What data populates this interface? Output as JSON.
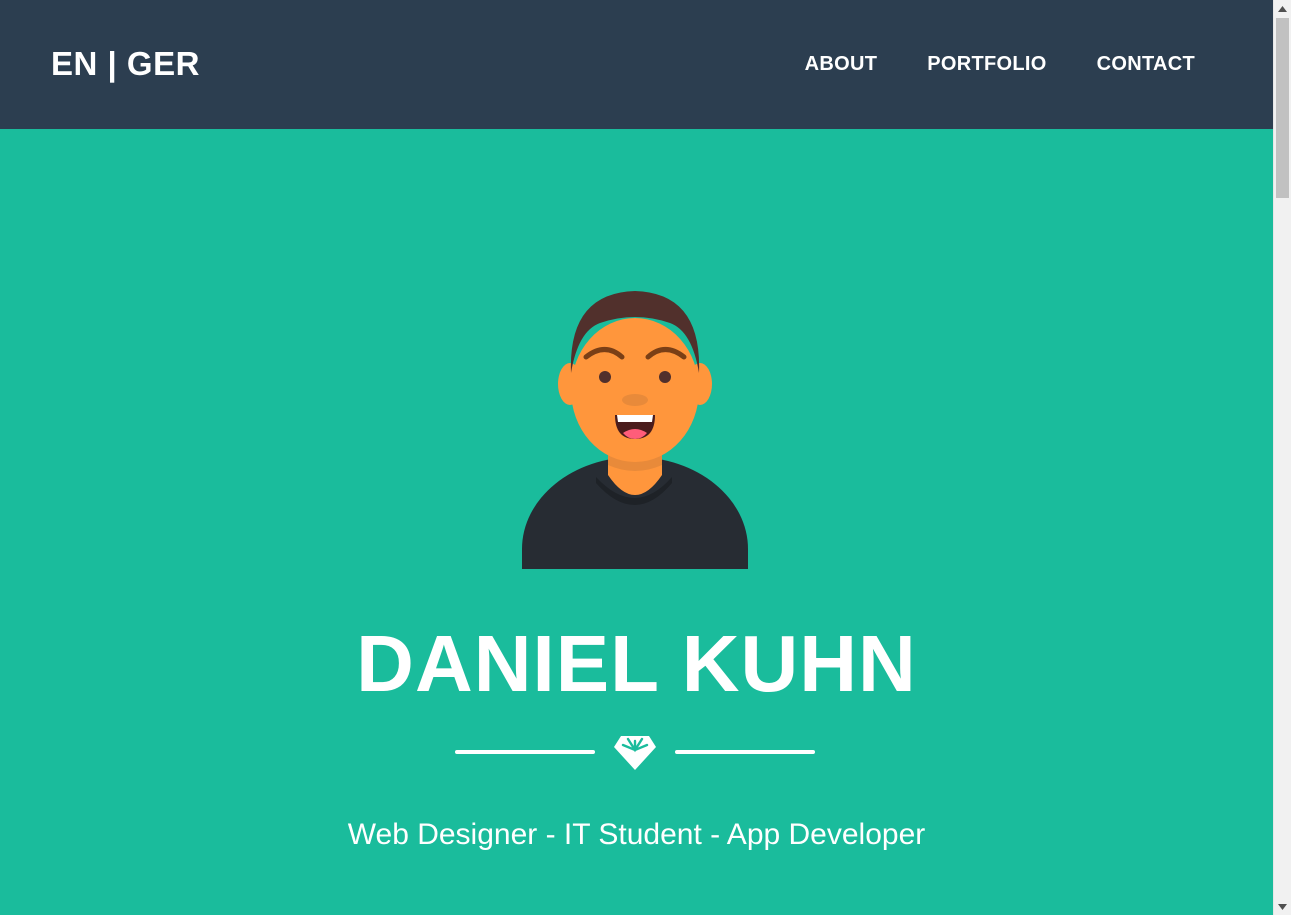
{
  "header": {
    "brand": "EN | GER",
    "nav": [
      {
        "label": "ABOUT"
      },
      {
        "label": "PORTFOLIO"
      },
      {
        "label": "CONTACT"
      }
    ]
  },
  "hero": {
    "name": "DANIEL KUHN",
    "tagline": "Web Designer - IT Student - App Developer",
    "avatar_icon": "person-avatar-icon",
    "divider_icon": "star-icon"
  },
  "colors": {
    "navbar_bg": "#2c3e50",
    "hero_bg": "#1abc9c",
    "text": "#ffffff",
    "skin": "#ff963c",
    "hair": "#51302c",
    "shirt": "#272c33"
  },
  "scrollbar": {
    "position_percent": 0
  }
}
